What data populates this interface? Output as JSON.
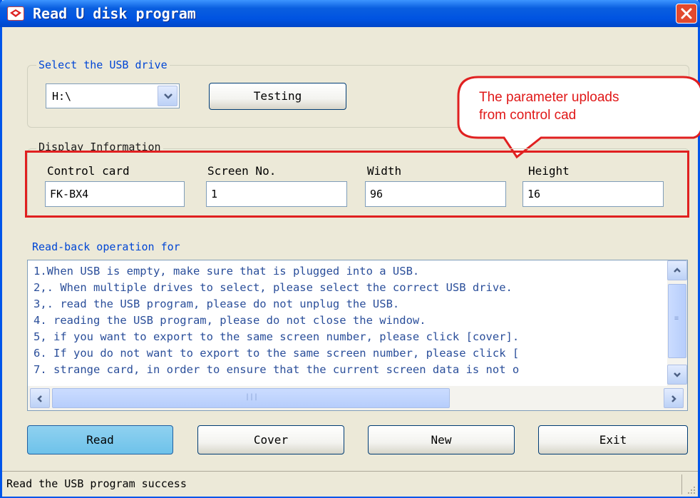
{
  "window": {
    "title": "Read U disk program",
    "title_bar_color": "#0053e1",
    "close_button_color": "#e2492e"
  },
  "usb_group": {
    "legend": "Select the USB drive",
    "drive_value": "H:\\",
    "testing_label": "Testing"
  },
  "callout": {
    "line1": "The parameter uploads",
    "line2": "from control cad",
    "color": "#e01818"
  },
  "display_group": {
    "legend": "Display Information",
    "fields": [
      {
        "label": "Control card",
        "value": "FK-BX4"
      },
      {
        "label": "Screen No.",
        "value": "1"
      },
      {
        "label": "Width",
        "value": "96"
      },
      {
        "label": "Height",
        "value": "16"
      }
    ],
    "highlight_color": "#e02020"
  },
  "readback_group": {
    "legend": "Read-back operation for",
    "lines": [
      "1.When USB is empty, make sure that is plugged into a USB.",
      "2,. When multiple drives to select, please select the correct USB drive.",
      "3,. read the USB program, please do not unplug the USB.",
      "4. reading the USB program, please do not close the window.",
      "5, if you want to export to the same screen number, please click [cover].",
      "6. If you do not want to export to the same screen number, please click [",
      "7. strange card, in order to ensure that the current screen data is not o"
    ]
  },
  "buttons": {
    "read": "Read",
    "cover": "Cover",
    "new": "New",
    "exit": "Exit"
  },
  "status": {
    "text": "Read the USB program success"
  }
}
